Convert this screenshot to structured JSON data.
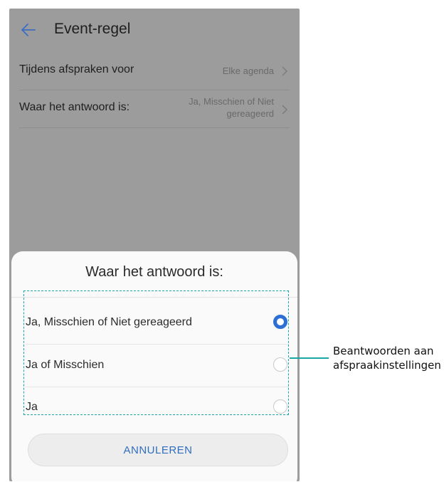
{
  "app": {
    "title": "Event-regel"
  },
  "settings": [
    {
      "label": "Tijdens afspraken voor",
      "value_lines": [
        "Elke agenda"
      ]
    },
    {
      "label": "Waar het antwoord is:",
      "value_lines": [
        "Ja, Misschien of Niet",
        "gereageerd"
      ]
    }
  ],
  "dialog": {
    "title": "Waar het antwoord is:",
    "options": [
      {
        "label": "Ja, Misschien of Niet gereageerd",
        "selected": true
      },
      {
        "label": "Ja of Misschien",
        "selected": false
      },
      {
        "label": "Ja",
        "selected": false
      }
    ],
    "cancel_label": "ANNULEREN"
  },
  "annotation": {
    "lines": [
      "Beantwoorden aan",
      "afspraakinstellingen"
    ]
  },
  "colors": {
    "accent": "#2d6fd4",
    "annotation": "#1aa7a7",
    "overlay": "#9c9c9c"
  },
  "icons": {
    "back": "arrow-left-icon",
    "chevron": "chevron-right-icon"
  }
}
